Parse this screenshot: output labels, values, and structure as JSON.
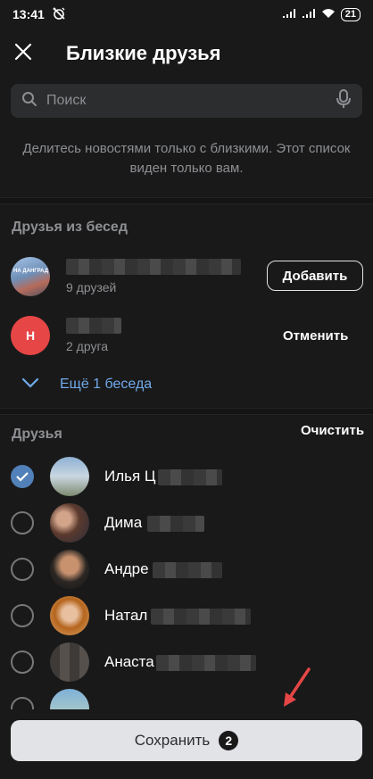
{
  "status_bar": {
    "time": "13:41",
    "battery": "21"
  },
  "header": {
    "title": "Близкие друзья"
  },
  "search": {
    "placeholder": "Поиск"
  },
  "info_text": "Делитесь новостями только с близкими. Этот список виден только вам.",
  "chats_section": {
    "title": "Друзья из бесед",
    "items": [
      {
        "subtitle": "9 друзей",
        "action": "Добавить",
        "avatar_text": "НА ДАНГРАД"
      },
      {
        "subtitle": "2 друга",
        "action": "Отменить",
        "avatar_letter": "Н"
      }
    ],
    "more_label": "Ещё 1 беседа"
  },
  "friends_section": {
    "title": "Друзья",
    "clear_label": "Очистить",
    "items": [
      {
        "name": "Илья Ц",
        "checked": true
      },
      {
        "name": "Дима",
        "checked": false
      },
      {
        "name": "Андре",
        "checked": false
      },
      {
        "name": "Натал",
        "checked": false
      },
      {
        "name": "Анаста",
        "checked": false
      },
      {
        "name": "",
        "checked": false
      }
    ]
  },
  "save": {
    "label": "Сохранить",
    "count": "2"
  },
  "colors": {
    "background": "#191919",
    "accent": "#5181b8",
    "link": "#71aaeb",
    "red_avatar": "#e64646",
    "arrow": "#e64646"
  }
}
